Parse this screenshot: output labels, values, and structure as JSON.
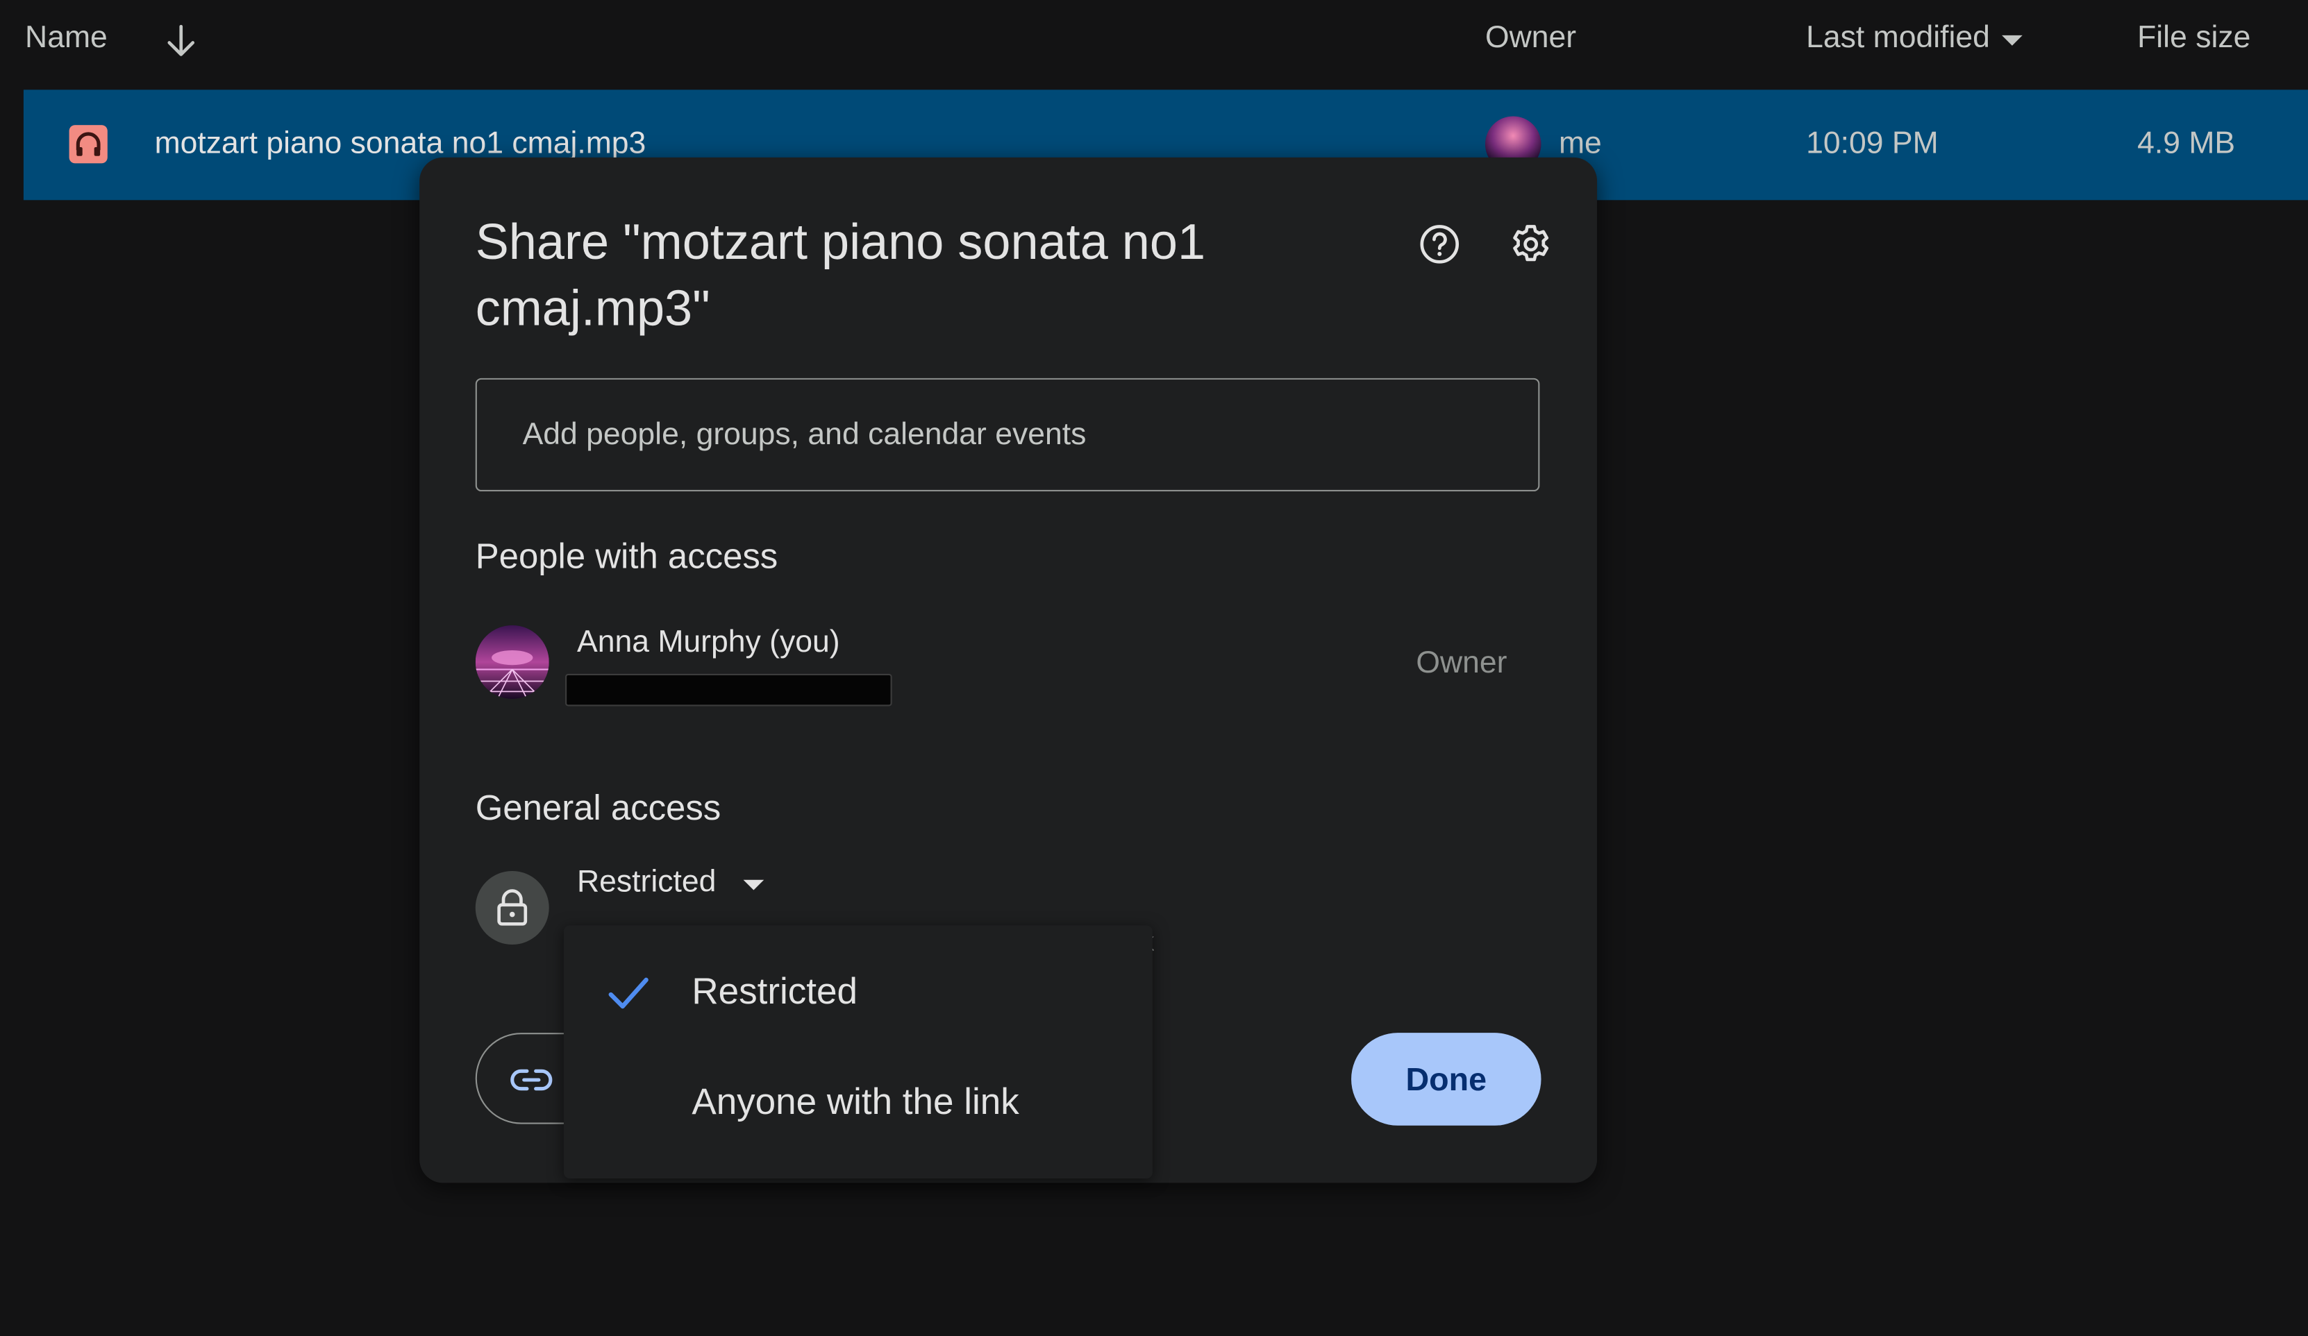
{
  "file_list": {
    "columns": {
      "name": "Name",
      "owner": "Owner",
      "last_modified": "Last modified",
      "file_size": "File size"
    },
    "rows": [
      {
        "icon": "audio-file-icon",
        "name": "motzart piano sonata no1 cmaj.mp3",
        "owner": "me",
        "last_modified": "10:09 PM",
        "file_size": "4.9 MB"
      }
    ]
  },
  "share_dialog": {
    "title": "Share \"motzart piano sonata no1 cmaj.mp3\"",
    "add_people_placeholder": "Add people, groups, and calendar events",
    "people_heading": "People with access",
    "people": [
      {
        "name": "Anna Murphy (you)",
        "role": "Owner"
      }
    ],
    "general_heading": "General access",
    "general_access_value": "Restricted",
    "behind_menu_text": "k",
    "done_label": "Done",
    "menu": {
      "options": [
        "Restricted",
        "Anyone with the link"
      ],
      "selected": "Restricted"
    }
  },
  "colors": {
    "background": "#131314",
    "dialog": "#1e1f20",
    "selected_row": "#004a77",
    "accent": "#a8c7fa",
    "check": "#4f8cf0",
    "audio_icon": "#f28b82"
  }
}
